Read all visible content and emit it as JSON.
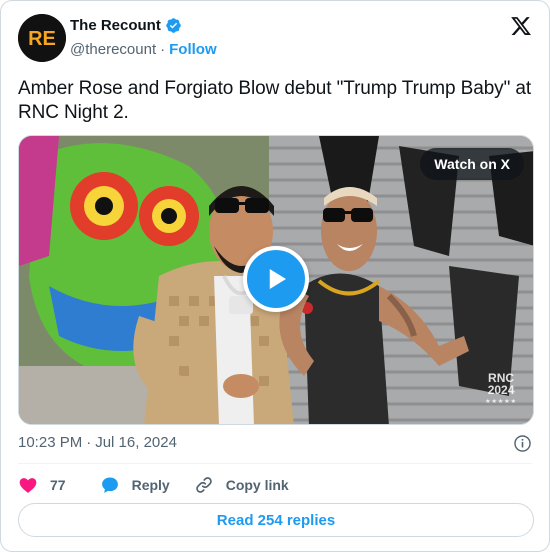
{
  "author": {
    "display_name": "The Recount",
    "handle": "@therecount",
    "separator": "·",
    "follow_label": "Follow",
    "avatar_text": "RE",
    "avatar_color": "#f5a623"
  },
  "tweet": {
    "text": "Amber Rose and Forgiato Blow debut \"Trump Trump Baby\" at RNC Night 2."
  },
  "media": {
    "watch_label": "Watch on X",
    "watermark_line1": "RNC",
    "watermark_line2": "2024",
    "watermark_stars": "★★★★★"
  },
  "meta": {
    "time": "10:23 PM",
    "separator": "·",
    "date": "Jul 16, 2024"
  },
  "actions": {
    "like_count": "77",
    "reply_label": "Reply",
    "copy_label": "Copy link"
  },
  "footer": {
    "read_replies_label": "Read 254 replies"
  },
  "colors": {
    "accent": "#1d9bf0",
    "like": "#f91880",
    "muted": "#536471"
  }
}
